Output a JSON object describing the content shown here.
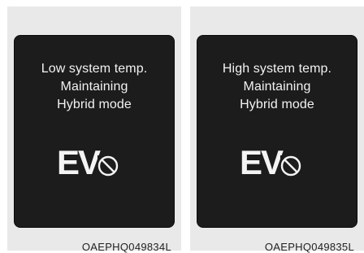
{
  "panels": [
    {
      "lines": [
        "Low system temp.",
        "Maintaining",
        "Hybrid mode"
      ],
      "mode_label": "EV",
      "mode_icon": "prohibited-icon",
      "caption": "OAEPHQ049834L"
    },
    {
      "lines": [
        "High system temp.",
        "Maintaining",
        "Hybrid mode"
      ],
      "mode_label": "EV",
      "mode_icon": "prohibited-icon",
      "caption": "OAEPHQ049835L"
    }
  ],
  "colors": {
    "screen_bg": "#1c1c1c",
    "panel_bg": "#e9e9e9",
    "text": "#f2f2f2"
  }
}
